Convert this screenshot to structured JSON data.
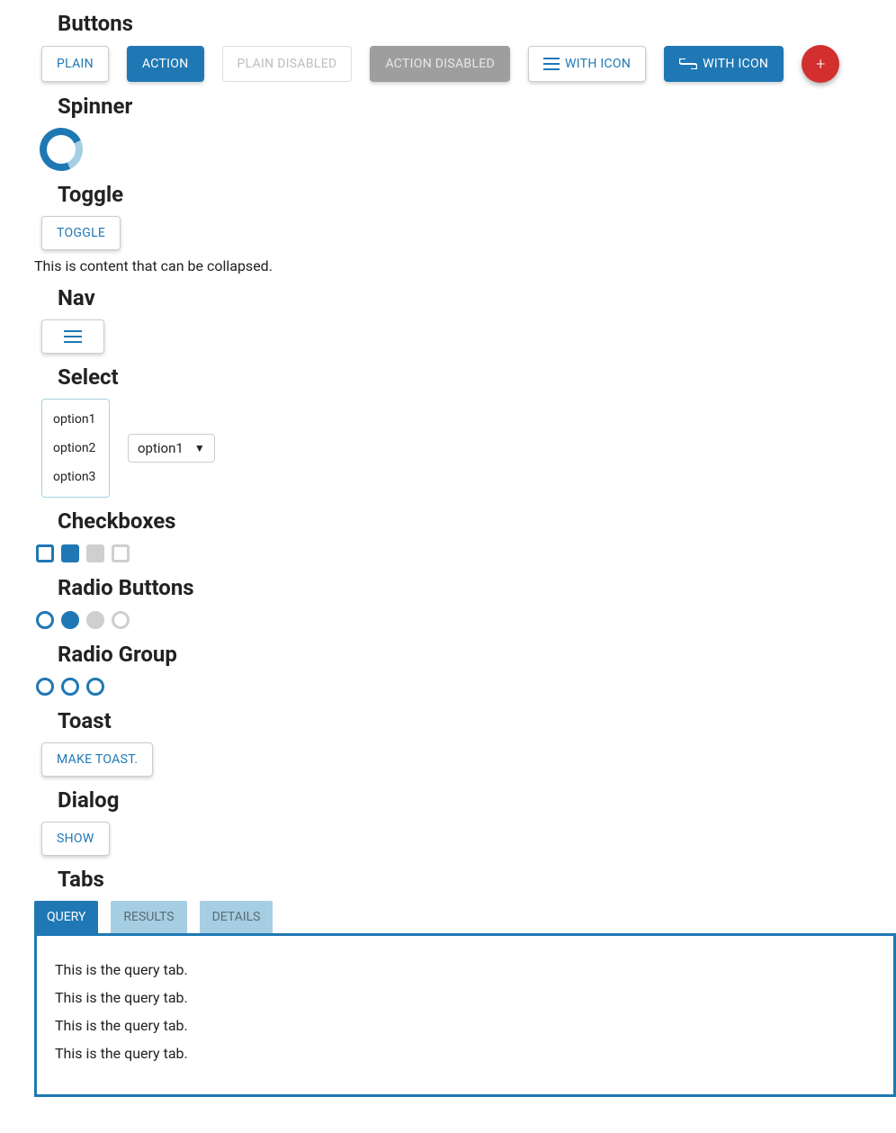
{
  "headings": {
    "buttons": "Buttons",
    "spinner": "Spinner",
    "toggle": "Toggle",
    "nav": "Nav",
    "select": "Select",
    "checkboxes": "Checkboxes",
    "radio_buttons": "Radio Buttons",
    "radio_group": "Radio Group",
    "toast": "Toast",
    "dialog": "Dialog",
    "tabs": "Tabs"
  },
  "buttons": {
    "plain": "PLAIN",
    "action": "ACTION",
    "plain_disabled": "PLAIN DISABLED",
    "action_disabled": "ACTION DISABLED",
    "with_icon_1": "WITH ICON",
    "with_icon_2": "WITH ICON",
    "fab": "+"
  },
  "toggle": {
    "button": "TOGGLE",
    "content": "This is content that can be collapsed."
  },
  "select": {
    "options": [
      "option1",
      "option2",
      "option3"
    ],
    "dropdown_value": "option1"
  },
  "toast": {
    "button": "MAKE TOAST."
  },
  "dialog": {
    "button": "SHOW"
  },
  "tabs": {
    "labels": [
      "QUERY",
      "RESULTS",
      "DETAILS"
    ],
    "active": 0,
    "panel_lines": [
      "This is the query tab.",
      "This is the query tab.",
      "This is the query tab.",
      "This is the query tab."
    ]
  },
  "colors": {
    "primary": "#1f78b4",
    "primary_light": "#a6cee3",
    "fab": "#d32f2f",
    "disabled": "#9e9e9e"
  }
}
